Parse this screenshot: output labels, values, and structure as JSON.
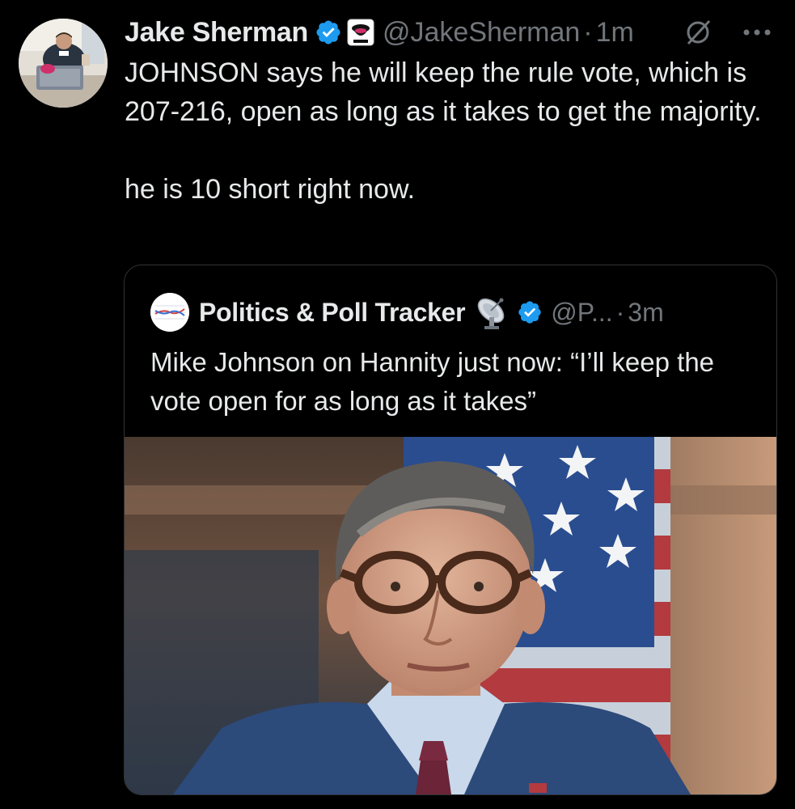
{
  "tweet": {
    "author_name": "Jake Sherman",
    "handle": "@JakeSherman",
    "separator": "·",
    "timestamp": "1m",
    "paragraphs": [
      "JOHNSON says he will keep the rule vote, which is 207-216, open as long as it takes to get the majority.",
      "he is 10 short right now."
    ],
    "icons": {
      "verified": "verified-badge-icon",
      "affiliation": "affiliate-logo-icon",
      "edit": "no-edit-icon",
      "more": "more-options-icon"
    }
  },
  "quoted_tweet": {
    "author_name": "Politics & Poll Tracker",
    "handle": "@P...",
    "separator": "·",
    "timestamp": "3m",
    "text": "Mike Johnson on Hannity just now: “I’ll keep the vote open for as long as it takes”",
    "icons": {
      "emoji": "satellite-dish-icon",
      "verified": "verified-badge-icon"
    }
  },
  "colors": {
    "background": "#000000",
    "text_primary": "#e7e9ea",
    "text_secondary": "#71767b",
    "verified_blue": "#1d9bf0",
    "card_border": "#2f3336"
  }
}
